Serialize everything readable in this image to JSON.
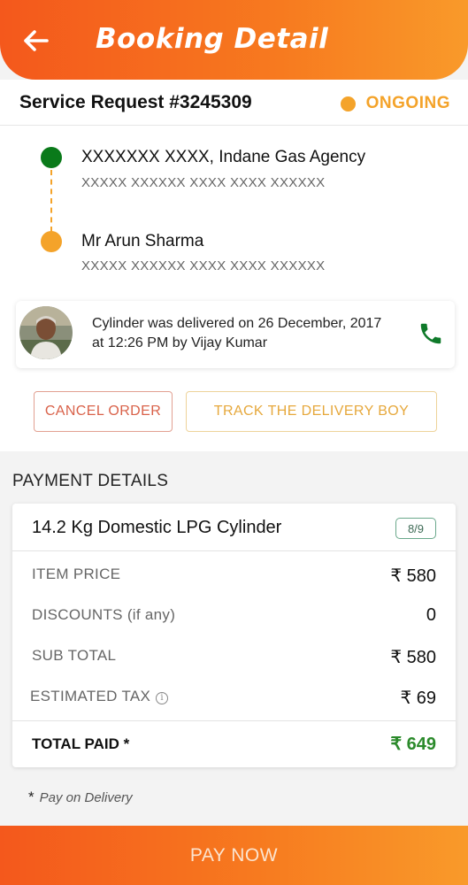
{
  "header": {
    "title": "Booking Detail",
    "back_icon": "arrow-left-icon"
  },
  "request": {
    "title": "Service Request #3245309",
    "status": "ONGOING",
    "status_color": "#f4a32a"
  },
  "route": {
    "from": {
      "name": "XXXXXXX XXXX, Indane Gas Agency",
      "address": "XXXXX XXXXXX XXXX XXXX XXXXXX",
      "color": "#0a7a1a"
    },
    "to": {
      "name": "Mr Arun Sharma",
      "address": "XXXXX XXXXXX XXXX XXXX XXXXXX",
      "color": "#f4a32a"
    }
  },
  "delivery": {
    "message": "Cylinder was delivered on 26 December, 2017 at 12:26 PM by Vijay Kumar",
    "call_icon": "phone-icon",
    "avatar_icon": "person-avatar"
  },
  "actions": {
    "cancel": "CANCEL ORDER",
    "track": "TRACK THE DELIVERY BOY"
  },
  "payment": {
    "heading": "PAYMENT DETAILS",
    "product": "14.2 Kg Domestic LPG Cylinder",
    "badge": "8/9",
    "rows": [
      {
        "label": "ITEM PRICE",
        "value": "₹ 580"
      },
      {
        "label": "DISCOUNTS (if any)",
        "value": "0"
      },
      {
        "label": "SUB TOTAL",
        "value": "₹ 580"
      },
      {
        "label": "ESTIMATED TAX",
        "value": "₹ 69"
      }
    ],
    "info_icon": "i",
    "total_label": "TOTAL PAID *",
    "total_value": "₹ 649",
    "total_color": "#2b8a2b"
  },
  "footnote": {
    "star": "*",
    "text": "Pay on Delivery"
  },
  "pay_button": "PAY NOW"
}
